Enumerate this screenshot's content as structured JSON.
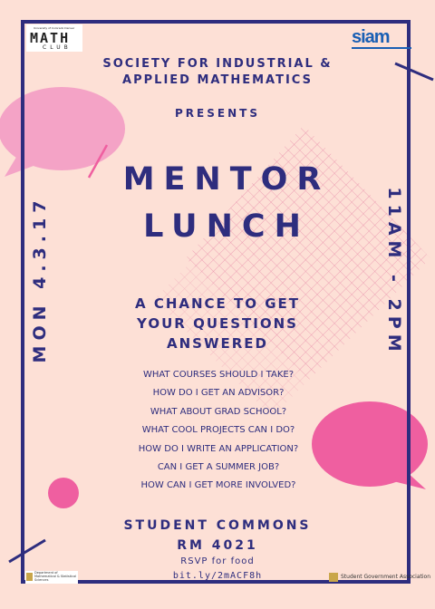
{
  "logos": {
    "math_club_small": "University of Colorado Denver",
    "math_club_big": "MATH",
    "math_club_sub": "CLUB",
    "siam": "siam",
    "dept": "Department of Mathematical & Statistical Sciences",
    "sga": "Student Government Association"
  },
  "header": {
    "org_line1": "SOCIETY FOR INDUSTRIAL &",
    "org_line2": "APPLIED MATHEMATICS",
    "presents": "PRESENTS"
  },
  "title": {
    "line1": "MENTOR",
    "line2": "LUNCH"
  },
  "side": {
    "date": "MON 4.3.17",
    "time": "11AM - 2PM"
  },
  "tagline": {
    "line1": "A CHANCE TO GET",
    "line2": "YOUR QUESTIONS",
    "line3": "ANSWERED"
  },
  "questions": [
    "WHAT COURSES SHOULD I TAKE?",
    "HOW DO I GET AN ADVISOR?",
    "WHAT ABOUT GRAD SCHOOL?",
    "WHAT COOL PROJECTS CAN I DO?",
    "HOW DO I WRITE AN APPLICATION?",
    "CAN I GET A SUMMER JOB?",
    "HOW CAN I GET MORE INVOLVED?"
  ],
  "location": {
    "line1": "STUDENT COMMONS",
    "line2": "RM 4021",
    "rsvp": "RSVP for food",
    "link": "bit.ly/2mACF8h"
  },
  "colors": {
    "background": "#fde0d6",
    "navy": "#2e2d7e",
    "pink": "#f4a3c6",
    "hot_pink": "#ef5fa0"
  }
}
